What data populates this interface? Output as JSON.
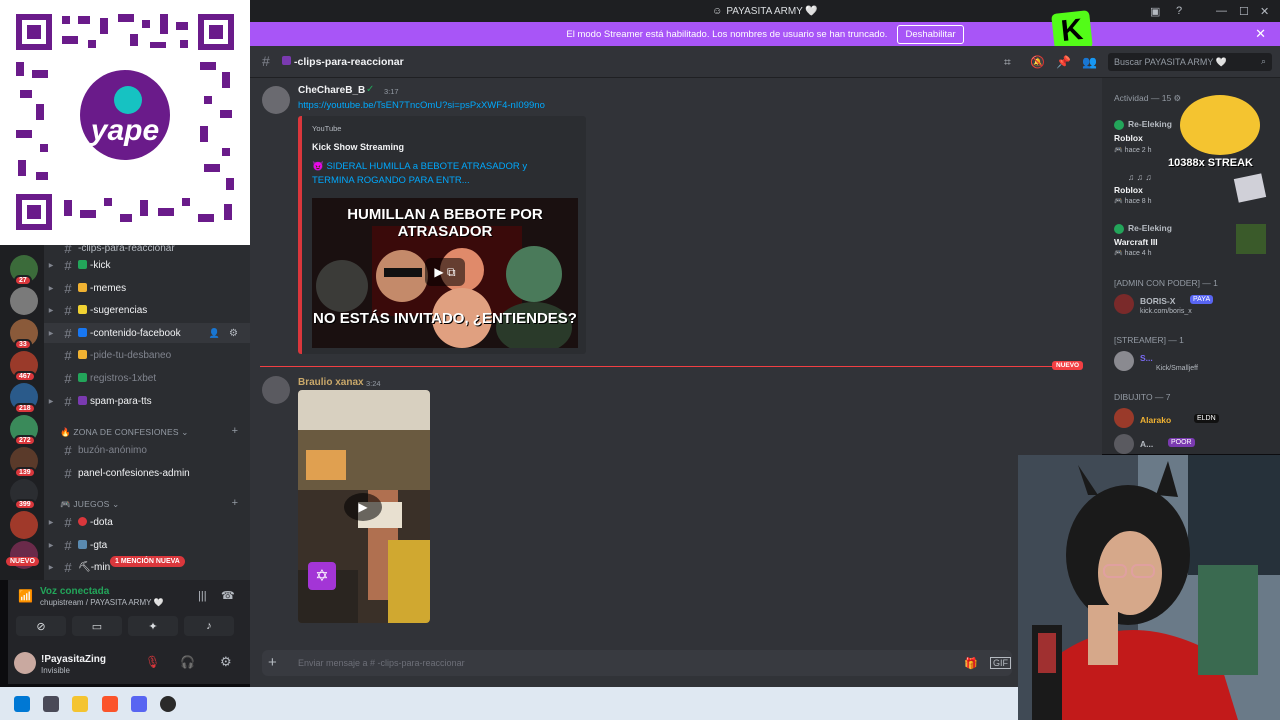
{
  "window": {
    "title": "PAYASITA ARMY 🤍"
  },
  "banner": {
    "text": "El modo Streamer está habilitado. Los nombres de usuario se han truncado.",
    "button": "Deshabilitar"
  },
  "overlay": {
    "qr_brand": "yape",
    "streak": "10388x STREAK"
  },
  "servers": {
    "badges": [
      "27",
      "33",
      "467",
      "218",
      "272",
      "139",
      "399"
    ],
    "new_label": "NUEVO"
  },
  "sidebar": {
    "channels": [
      {
        "name": "-clips-para-reaccionar"
      },
      {
        "name": "-kick"
      },
      {
        "name": "-memes"
      },
      {
        "name": "-sugerencias"
      },
      {
        "name": "-contenido-facebook"
      },
      {
        "name": "-pide-tu-desbaneo"
      },
      {
        "name": "registros-1xbet"
      },
      {
        "name": "spam-para-tts"
      }
    ],
    "category_confesiones": "ZONA DE CONFESIONES",
    "confesiones_channels": [
      {
        "name": "buzón-anónimo"
      },
      {
        "name": "panel-confesiones-admin"
      }
    ],
    "category_juegos": "JUEGOS",
    "juegos_channels": [
      {
        "name": "-dota"
      },
      {
        "name": "-gta"
      },
      {
        "name": "-min"
      }
    ],
    "mention_badge": "1 MENCIÓN NUEVA"
  },
  "voice": {
    "status": "Voz conectada",
    "location": "chupistream / PAYASITA ARMY 🤍"
  },
  "user": {
    "name": "!PayasitaZing",
    "status": "Invisible"
  },
  "header": {
    "channel": "-clips-para-reaccionar",
    "search_placeholder": "Buscar PAYASITA ARMY 🤍"
  },
  "messages": [
    {
      "author": "CheChareB_B",
      "time": "3:17",
      "link": "https://youtube.be/TsEN7TncOmU?si=psPxXWF4-nI099no",
      "embed": {
        "provider": "YouTube",
        "title": "Kick Show Streaming",
        "video_title": "SIDERAL HUMILLA a BEBOTE ATRASADOR y TERMINA ROGANDO PARA ENTR...",
        "thumb_top": "HUMILLAN A BEBOTE POR ATRASADOR",
        "thumb_bottom": "NO ESTÁS INVITADO, ¿ENTIENDES?"
      }
    },
    {
      "author": "Braulio xanax",
      "time": "3:24"
    }
  ],
  "divider_label": "NUEVO",
  "composer": {
    "placeholder": "Enviar mensaje a # -clips-para-reaccionar"
  },
  "members": {
    "activity_header": "Actividad — 15",
    "activity": [
      {
        "name": "Re-Eleking",
        "game": "Roblox",
        "time": "hace 2 h"
      },
      {
        "name": "♫ ♫ ♫",
        "game": "Roblox",
        "time": "hace 8 h"
      },
      {
        "name": "Re-Eleking",
        "game": "Warcraft III",
        "time": "hace 4 h"
      }
    ],
    "admin_header": "[ADMIN CON PODER] — 1",
    "admin": {
      "name": "BORIS-X",
      "tag": "PAYA",
      "sub": "kick.com/boris_x"
    },
    "streamer_header": "[STREAMER] — 1",
    "streamer": {
      "name": "S...",
      "sub": "Kick/Smalljeff"
    },
    "dibujito_header": "DIBUJITO — 7",
    "dibujito": [
      {
        "name": "Alarako",
        "tag": "ELDN"
      },
      {
        "name": "A...",
        "tag": "POOR"
      }
    ]
  },
  "colors": {
    "banner": "#a855f7",
    "accent_red": "#f23f43",
    "link": "#00a8fc",
    "kick": "#53fc18"
  }
}
